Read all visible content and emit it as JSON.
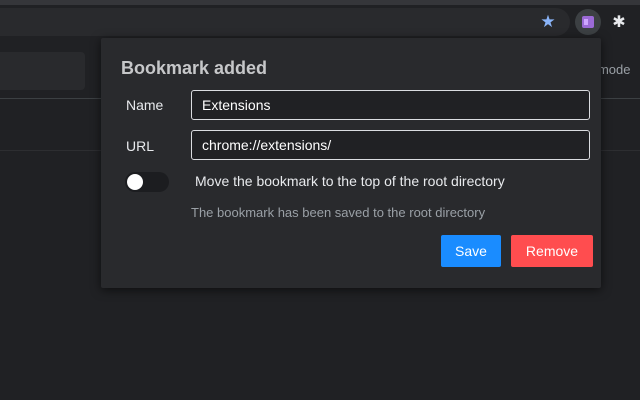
{
  "browser": {
    "page_text_fragment": "r mode"
  },
  "popup": {
    "title": "Bookmark added",
    "name_label": "Name",
    "name_value": "Extensions",
    "url_label": "URL",
    "url_value": "chrome://extensions/",
    "toggle_on": false,
    "toggle_label": "Move the bookmark to the top of the root directory",
    "hint": "The bookmark has been saved to the root directory",
    "save_label": "Save",
    "remove_label": "Remove"
  },
  "icons": {
    "star": "star-icon",
    "extension": "bookmark-extension-icon",
    "puzzle": "puzzle-icon"
  },
  "colors": {
    "save_button": "#1a8cff",
    "remove_button": "#ff4d4f",
    "star": "#8ab4f8"
  }
}
